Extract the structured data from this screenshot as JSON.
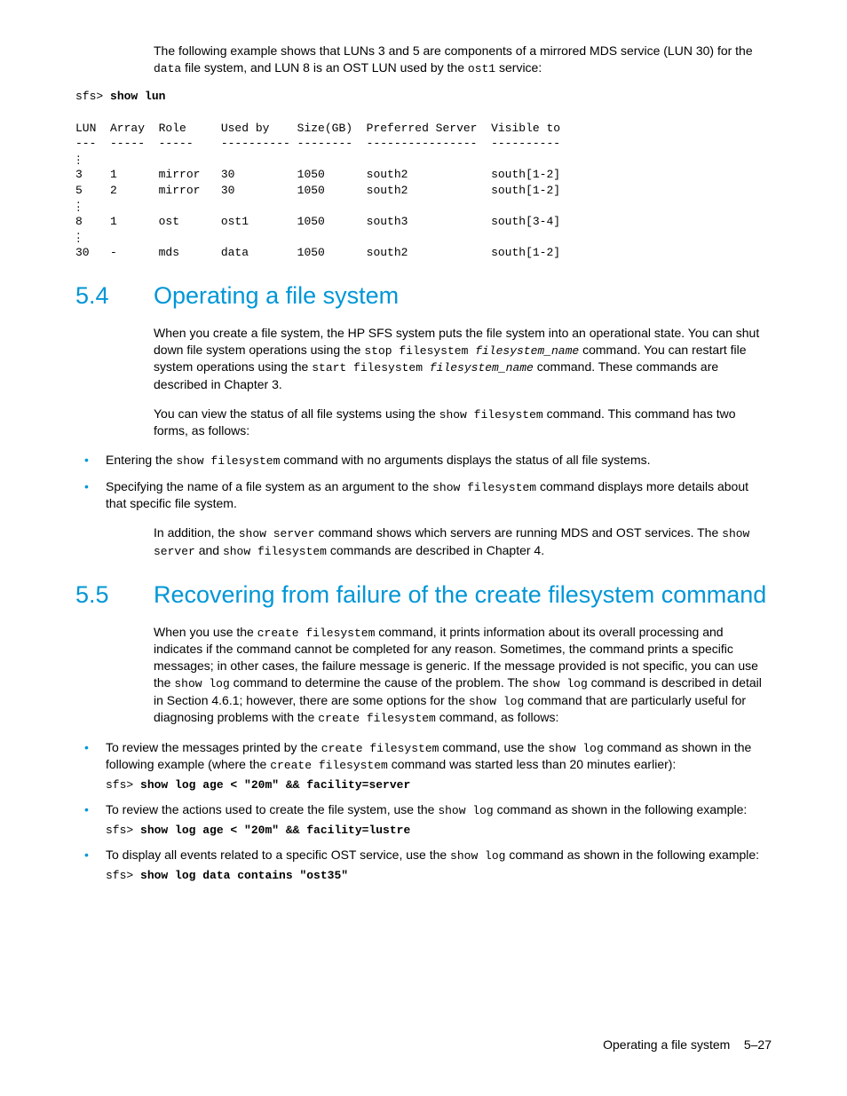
{
  "intro_before_data": "The following example shows that LUNs 3 and 5 are components of a mirrored MDS service (LUN 30) for the ",
  "intro_code1": "data",
  "intro_mid": " file system, and LUN 8 is an OST LUN used by the ",
  "intro_code2": "ost1",
  "intro_after": " service:",
  "prompt": "sfs> ",
  "show_lun_cmd": "show lun",
  "lun_header": "LUN  Array  Role     Used by    Size(GB)  Preferred Server  Visible to",
  "lun_divider": "---  -----  -----    ---------- --------  ----------------  ----------",
  "lun_rows": [
    "3    1      mirror   30         1050      south2            south[1-2]",
    "5    2      mirror   30         1050      south2            south[1-2]",
    "8    1      ost      ost1       1050      south3            south[3-4]",
    "30   -      mds      data       1050      south2            south[1-2]"
  ],
  "sec54_num": "5.4",
  "sec54_title": "Operating a file system",
  "sec54_p1_a": "When you create a file system, the HP SFS system puts the file system into an operational state. You can shut down file system operations using the ",
  "sec54_p1_code1": "stop filesystem ",
  "sec54_p1_italic1": "filesystem_name",
  "sec54_p1_b": " command. You can restart file system operations using the ",
  "sec54_p1_code2": "start filesystem ",
  "sec54_p1_italic2": "filesystem_name",
  "sec54_p1_c": " command. These commands are described in Chapter 3.",
  "sec54_p2_a": "You can view the status of all file systems using the ",
  "sec54_p2_code": "show filesystem",
  "sec54_p2_b": " command. This command has two forms, as follows:",
  "sec54_b1_a": "Entering the ",
  "sec54_b1_code": "show filesystem",
  "sec54_b1_b": " command with no arguments displays the status of all file systems.",
  "sec54_b2_a": "Specifying the name of a file system as an argument to the ",
  "sec54_b2_code": "show filesystem",
  "sec54_b2_b": " command displays more details about that specific file system.",
  "sec54_p3_a": "In addition, the ",
  "sec54_p3_code1": "show server",
  "sec54_p3_b": " command shows which servers are running MDS and OST services. The ",
  "sec54_p3_code2": "show server",
  "sec54_p3_c": " and ",
  "sec54_p3_code3": "show filesystem",
  "sec54_p3_d": " commands are described in Chapter 4.",
  "sec55_num": "5.5",
  "sec55_title": "Recovering from failure of the create filesystem command",
  "sec55_p1_a": "When you use the ",
  "sec55_p1_code1": "create filesystem",
  "sec55_p1_b": " command, it prints information about its overall processing and indicates if the command cannot be completed for any reason. Sometimes, the command prints a specific messages; in other cases, the failure message is generic. If the message provided is not specific, you can use the ",
  "sec55_p1_code2": "show log",
  "sec55_p1_c": " command to determine the cause of the problem. The ",
  "sec55_p1_code3": "show log",
  "sec55_p1_d": " command is described in detail in Section 4.6.1; however, there are some options for the ",
  "sec55_p1_code4": "show log",
  "sec55_p1_e": " command that are particularly useful for diagnosing problems with the ",
  "sec55_p1_code5": "create filesystem",
  "sec55_p1_f": " command, as follows:",
  "sec55_b1_a": "To review the messages printed by the ",
  "sec55_b1_code1": "create filesystem",
  "sec55_b1_b": " command, use the ",
  "sec55_b1_code2": "show log",
  "sec55_b1_c": " command as shown in the following example (where the ",
  "sec55_b1_code3": "create filesystem",
  "sec55_b1_d": " command was started less than 20 minutes earlier):",
  "sec55_b1_cmd": "show log age < \"20m\" && facility=server",
  "sec55_b2_a": "To review the actions used to create the file system, use the ",
  "sec55_b2_code1": "show log",
  "sec55_b2_b": " command as shown in the following example:",
  "sec55_b2_cmd": "show log age < \"20m\" && facility=lustre",
  "sec55_b3_a": "To display all events related to a specific OST service, use the ",
  "sec55_b3_code1": "show log",
  "sec55_b3_b": " command as shown in the following example:",
  "sec55_b3_cmd": "show log data contains \"ost35\"",
  "footer_text": "Operating a file system",
  "footer_page": "5–27"
}
